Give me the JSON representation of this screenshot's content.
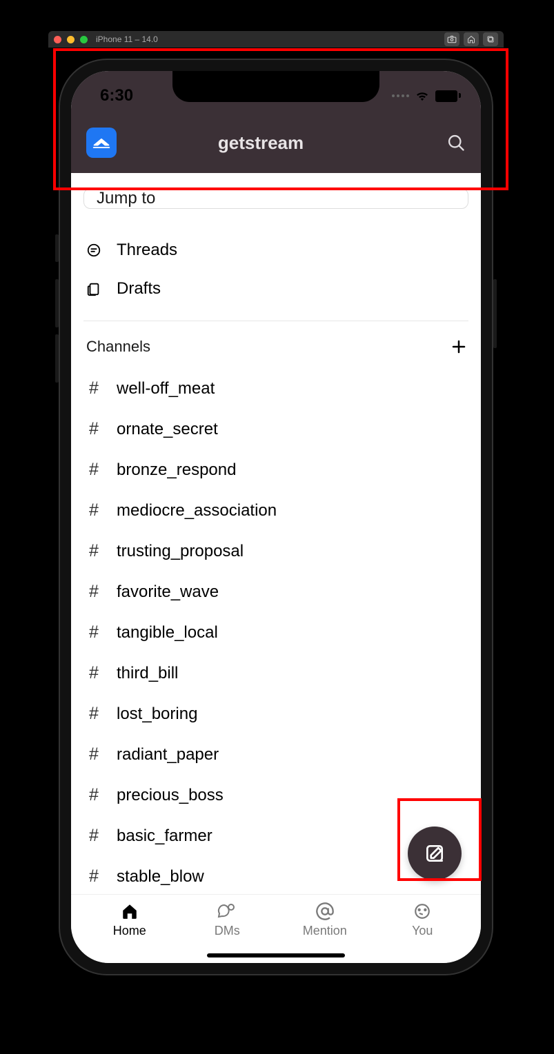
{
  "simulator": {
    "title": "iPhone 11 – 14.0"
  },
  "status_bar": {
    "time": "6:30"
  },
  "header": {
    "title": "getstream"
  },
  "search": {
    "jump_to_label": "Jump to"
  },
  "quick_links": {
    "threads": "Threads",
    "drafts": "Drafts"
  },
  "channels_section": {
    "title": "Channels"
  },
  "channels": [
    {
      "name": "well-off_meat"
    },
    {
      "name": "ornate_secret"
    },
    {
      "name": "bronze_respond"
    },
    {
      "name": "mediocre_association"
    },
    {
      "name": "trusting_proposal"
    },
    {
      "name": "favorite_wave"
    },
    {
      "name": "tangible_local"
    },
    {
      "name": "third_bill"
    },
    {
      "name": "lost_boring"
    },
    {
      "name": "radiant_paper"
    },
    {
      "name": "precious_boss"
    },
    {
      "name": "basic_farmer"
    },
    {
      "name": "stable_blow"
    }
  ],
  "tabs": {
    "home": "Home",
    "dms": "DMs",
    "mention": "Mention",
    "you": "You"
  }
}
